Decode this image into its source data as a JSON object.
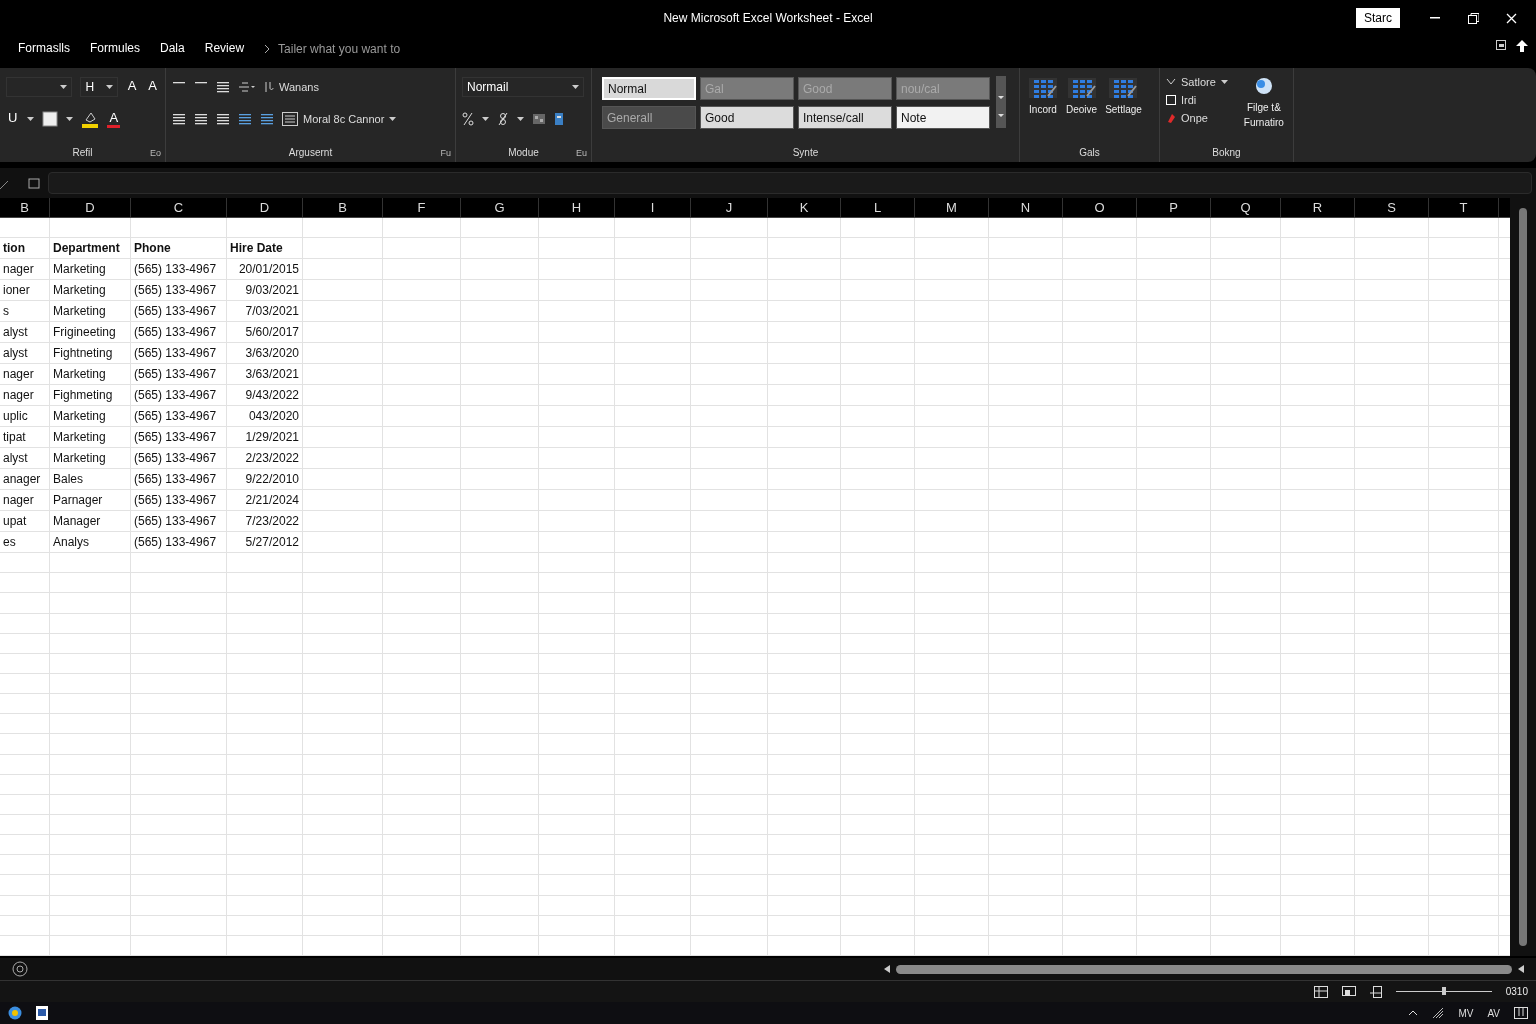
{
  "window": {
    "title": "New Microsoft Excel Worksheet - Excel",
    "account": "Starc"
  },
  "tabs": [
    {
      "label": "Formaslls",
      "selected": false
    },
    {
      "label": "Formules",
      "selected": false
    },
    {
      "label": "Dala",
      "selected": false
    },
    {
      "label": "Review",
      "selected": false
    }
  ],
  "tell_me": {
    "placeholder": "Tailer what you want to"
  },
  "ribbon": {
    "font": {
      "label": "Refil",
      "launcher": "Eo",
      "size": "H",
      "grow": "A",
      "shrink": "A",
      "underline": "U",
      "font_color": "A"
    },
    "alignment": {
      "label": "Argusernt",
      "launcher": "Fu",
      "wrap": "Wanans",
      "merge": "Moral 8c Cannor"
    },
    "number": {
      "label": "Modue",
      "launcher": "Eu",
      "format": "Normail"
    },
    "styles": {
      "label": "Synte",
      "items": [
        {
          "label": "Normal",
          "color": "#d9d9d9",
          "selected": true
        },
        {
          "label": "Gal",
          "color": "#7a7a7a",
          "selected": false
        },
        {
          "label": "Good",
          "color": "#7a7a7a",
          "selected": false
        },
        {
          "label": "nou/cal",
          "color": "#7a7a7a",
          "selected": false
        },
        {
          "label": "Generall",
          "color": "#4a4a4a",
          "selected": false
        },
        {
          "label": "Good",
          "color": "#dcdcdc",
          "selected": false
        },
        {
          "label": "Intense/call",
          "color": "#dcdcdc",
          "selected": false
        },
        {
          "label": "Note",
          "color": "#f2f2f2",
          "selected": false
        }
      ]
    },
    "cells": {
      "label": "Gals",
      "items": [
        "Incord",
        "Deoive",
        "Settlage"
      ]
    },
    "editing": {
      "label": "Bokng",
      "sort": "Satlore",
      "fill": "Irdi",
      "clear": "Onpe",
      "find": [
        "Filge t&",
        "Furnatiro"
      ]
    }
  },
  "sheet": {
    "columns": [
      "B",
      "D",
      "C",
      "D",
      "B",
      "F",
      "G",
      "H",
      "I",
      "J",
      "K",
      "L",
      "M",
      "N",
      "O",
      "P",
      "Q",
      "R",
      "S",
      "T"
    ],
    "header": [
      "tion",
      "Department",
      "Phone",
      "Hire Date"
    ],
    "rows": [
      [
        "nager",
        "Marketing",
        "(565) 133-4967",
        "20/01/2015"
      ],
      [
        "ioner",
        "Marketing",
        "(565) 133-4967",
        "9/03/2021"
      ],
      [
        "s",
        "Marketing",
        "(565) 133-4967",
        "7/03/2021"
      ],
      [
        "alyst",
        "Frigineeting",
        "(565) 133-4967",
        "5/60/2017"
      ],
      [
        "alyst",
        "Fightneting",
        "(565) 133-4967",
        "3/63/2020"
      ],
      [
        "nager",
        "Marketing",
        "(565) 133-4967",
        "3/63/2021"
      ],
      [
        "nager",
        "Fighmeting",
        "(565) 133-4967",
        "9/43/2022"
      ],
      [
        "uplic",
        "Marketing",
        "(565) 133-4967",
        "043/2020"
      ],
      [
        "tipat",
        "Marketing",
        "(565) 133-4967",
        "1/29/2021"
      ],
      [
        "alyst",
        "Marketing",
        "(565) 133-4967",
        "2/23/2022"
      ],
      [
        "anager",
        "Bales",
        "(565) 133-4967",
        "9/22/2010"
      ],
      [
        "nager",
        "Parnager",
        "(565) 133-4967",
        "2/21/2024"
      ],
      [
        "upat",
        "Manager",
        "(565) 133-4967",
        "7/23/2022"
      ],
      [
        "es",
        "Analys",
        "(565) 133-4967",
        "5/27/2012"
      ]
    ]
  },
  "status_bar": {
    "zoom": {
      "level": 0.5
    },
    "zoom_reading": "0310"
  },
  "taskbar": {
    "tray": [
      "MV",
      "AV"
    ]
  }
}
